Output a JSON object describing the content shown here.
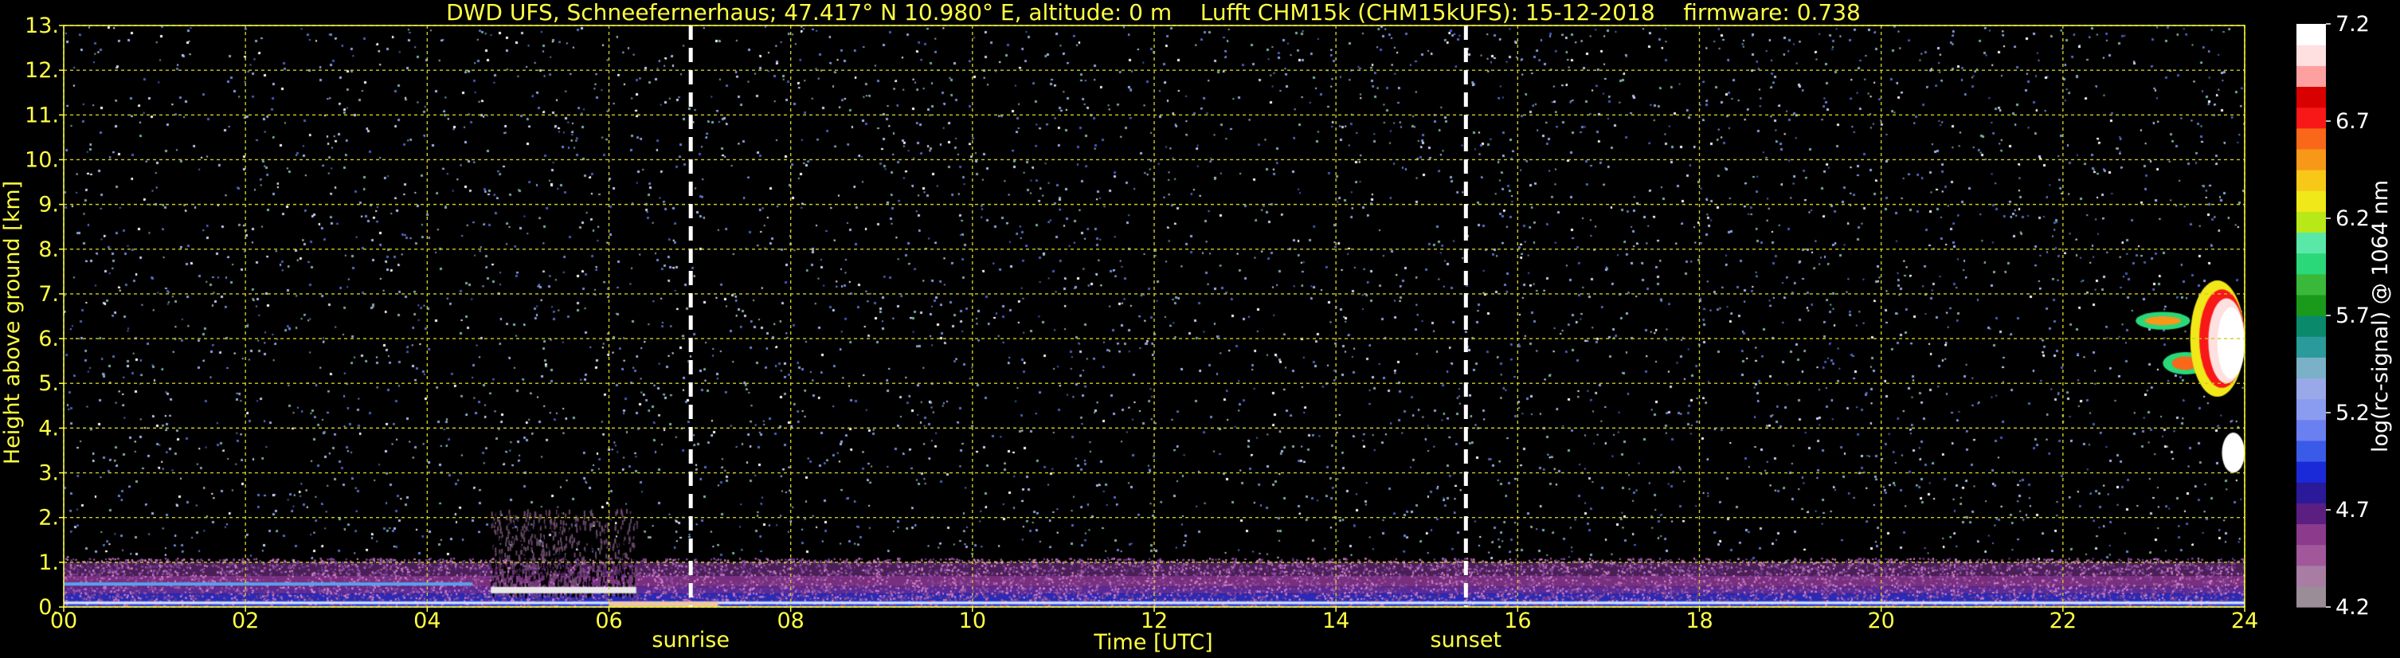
{
  "chart_data": {
    "type": "heatmap",
    "title": "DWD UFS, Schneefernerhaus; 47.417° N 10.980° E, altitude: 0 m    Lufft CHM15k (CHM15kUFS): 15-12-2018    firmware: 0.738",
    "xlabel": "Time [UTC]",
    "ylabel": "Height above ground [km]",
    "xlim": [
      0,
      24
    ],
    "ylim": [
      0,
      13
    ],
    "x_ticks": [
      "00",
      "02",
      "04",
      "06",
      "08",
      "10",
      "12",
      "14",
      "16",
      "18",
      "20",
      "22",
      "24"
    ],
    "y_ticks": [
      "0.",
      "1.",
      "2.",
      "3.",
      "4.",
      "5.",
      "6.",
      "7.",
      "8.",
      "9.",
      "10.",
      "11.",
      "12.",
      "13."
    ],
    "grid": true,
    "markers": [
      {
        "label": "sunrise",
        "time": 6.9
      },
      {
        "label": "sunset",
        "time": 15.43
      }
    ],
    "features": [
      {
        "kind": "boundary layer",
        "time": [
          0,
          24
        ],
        "height": [
          0,
          1.0
        ]
      },
      {
        "kind": "precipitation streaks",
        "time": [
          4.7,
          6.3
        ],
        "height": [
          0.2,
          2.2
        ]
      },
      {
        "kind": "cloud",
        "time": [
          22.8,
          24
        ],
        "height": [
          4.7,
          7.3
        ]
      },
      {
        "kind": "cloud",
        "time": [
          23.7,
          24
        ],
        "height": [
          3.0,
          3.9
        ]
      }
    ],
    "colorbar": {
      "label": "log(rc-signal) @ 1064 nm",
      "range": [
        4.2,
        7.2
      ],
      "ticks": [
        "4.2",
        "4.7",
        "5.2",
        "5.7",
        "6.2",
        "6.7",
        "7.2"
      ],
      "colors": [
        "#9a8d98",
        "#a87ca3",
        "#a0589a",
        "#8c3b8c",
        "#5a1f80",
        "#2a1a9a",
        "#1a2ad8",
        "#3a5ae8",
        "#6a80f0",
        "#8a9cf0",
        "#99a8e8",
        "#7ab0c8",
        "#2a9a9a",
        "#0a8a6a",
        "#1a9a1a",
        "#3ab83a",
        "#2ad87a",
        "#5ae8a8",
        "#b8e818",
        "#f0e818",
        "#f8c818",
        "#f89818",
        "#f86818",
        "#f81818",
        "#d80000",
        "#ffa0a0",
        "#ffe0e0",
        "#ffffff"
      ]
    }
  }
}
